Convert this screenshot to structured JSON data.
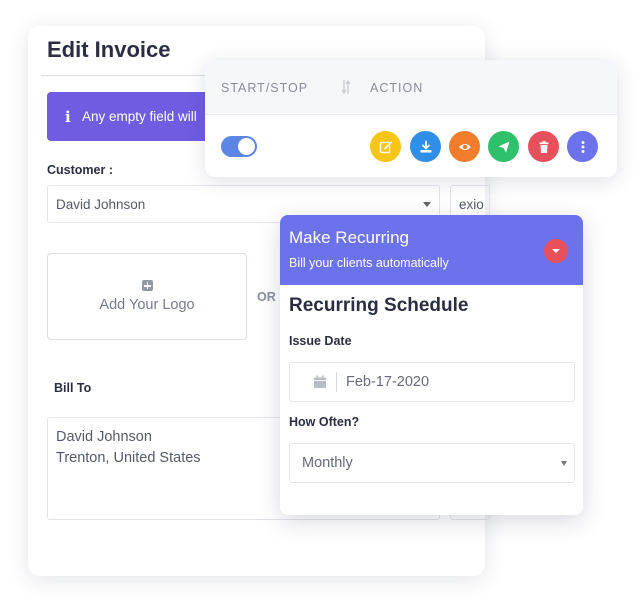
{
  "invoice": {
    "title": "Edit Invoice",
    "info_banner": "Any empty field will",
    "customer_label": "Customer :",
    "customer_value": "David Johnson",
    "partial_field_value": "exio",
    "logo_label": "Add Your Logo",
    "or_text": "OR",
    "bill_to_label": "Bill To",
    "bill_to_lines": [
      "David Johnson",
      "Trenton, United States"
    ]
  },
  "actions": {
    "header_start_stop": "START/STOP",
    "header_action": "ACTION",
    "toggle_on": true,
    "buttons": [
      {
        "icon": "edit-icon",
        "color": "#f5c518"
      },
      {
        "icon": "download-icon",
        "color": "#2f8ee5"
      },
      {
        "icon": "eye-icon",
        "color": "#f07d2c"
      },
      {
        "icon": "send-icon",
        "color": "#2ec06a"
      },
      {
        "icon": "trash-icon",
        "color": "#e8505b"
      },
      {
        "icon": "more-icon",
        "color": "#6b72ec"
      }
    ]
  },
  "recurring": {
    "title": "Make Recurring",
    "subtitle": "Bill your clients automatically",
    "schedule_title": "Recurring Schedule",
    "issue_date_label": "Issue Date",
    "issue_date_value": "Feb-17-2020",
    "how_often_label": "How Often?",
    "how_often_value": "Monthly"
  },
  "colors": {
    "accent_purple": "#6f5ce0",
    "recurring_header": "#6b72ec",
    "toggle_blue": "#5b86e5"
  }
}
